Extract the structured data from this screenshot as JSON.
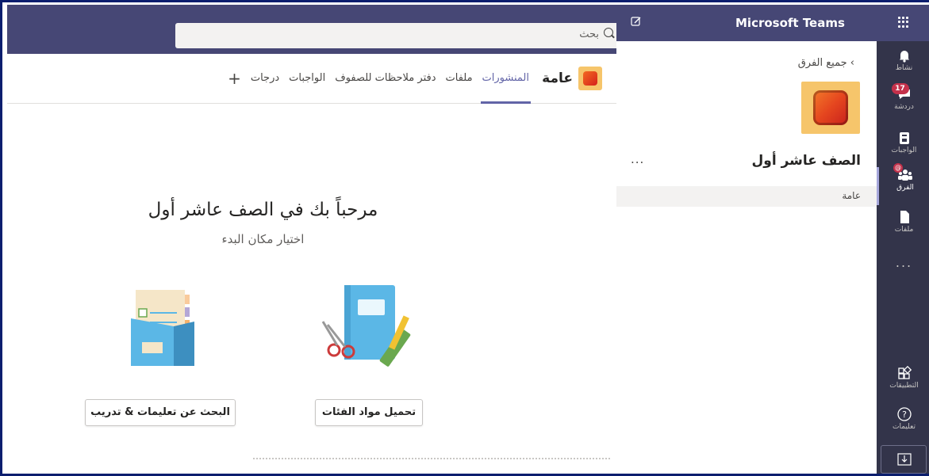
{
  "app": {
    "title": "Microsoft Teams"
  },
  "search": {
    "placeholder": "بحث"
  },
  "channel_header": {
    "channel_name": "عامة",
    "tabs": [
      "المنشورات",
      "ملفات",
      "دفتر ملاحظات للصفوف",
      "الواجبات",
      "درجات"
    ],
    "active_tab": "المنشورات",
    "add_tab": "+"
  },
  "welcome": {
    "title": "مرحباً بك في الصف عاشر أول",
    "subtitle": "اختيار مكان البدء",
    "buttons": {
      "upload": "تحميل مواد الفئات",
      "help": "البحث عن تعليمات & تدريب"
    }
  },
  "team_panel": {
    "back_label": "جميع الفرق",
    "team_name": "الصف عاشر أول",
    "more": "...",
    "channels": [
      "عامة"
    ]
  },
  "rail": {
    "items": [
      {
        "label": "نشاط",
        "icon": "bell-icon"
      },
      {
        "label": "دردشة",
        "icon": "chat-icon",
        "badge": "17"
      },
      {
        "label": "الواجبات",
        "icon": "assignments-icon"
      },
      {
        "label": "الفرق",
        "icon": "teams-icon",
        "badge": "@"
      },
      {
        "label": "ملفات",
        "icon": "files-icon"
      }
    ],
    "more": "...",
    "apps": "التطبيقات",
    "help": "تعليمات"
  },
  "colors": {
    "brand": "#464775",
    "rail": "#33344a",
    "accent": "#6264a7",
    "badge": "#c4314b"
  }
}
